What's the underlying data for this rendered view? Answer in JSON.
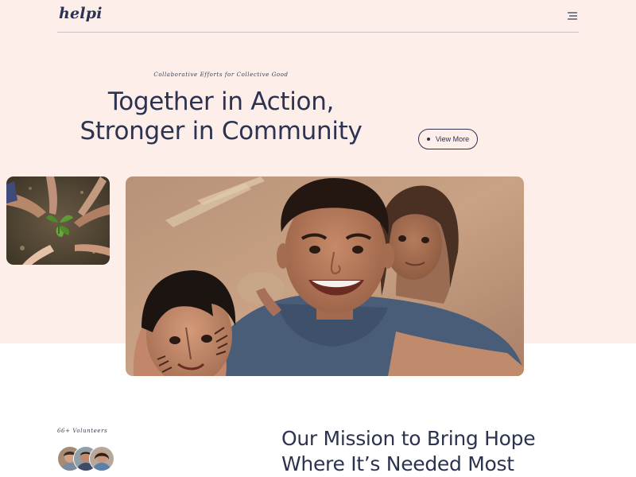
{
  "brand": {
    "logo": "helpi"
  },
  "header": {
    "menu_icon": "hamburger-menu-icon"
  },
  "hero": {
    "tagline": "Collaborative Efforts for Collective Good",
    "title_line1": "Together in Action,",
    "title_line2": "Stronger in Community",
    "cta_label": "View More"
  },
  "images": {
    "small": "hands-planting-seedling-photo",
    "main": "smiling-young-man-with-children-selfie-photo"
  },
  "volunteers": {
    "label": "66+ Volunteers",
    "avatars": [
      "volunteer-avatar-1",
      "volunteer-avatar-2",
      "volunteer-avatar-3"
    ]
  },
  "mission": {
    "title_line1": "Our Mission to Bring Hope",
    "title_line2": "Where It’s Needed Most"
  },
  "colors": {
    "hero_background": "#fdeeea",
    "text_primary": "#2b3350",
    "page_background": "#ffffff"
  }
}
